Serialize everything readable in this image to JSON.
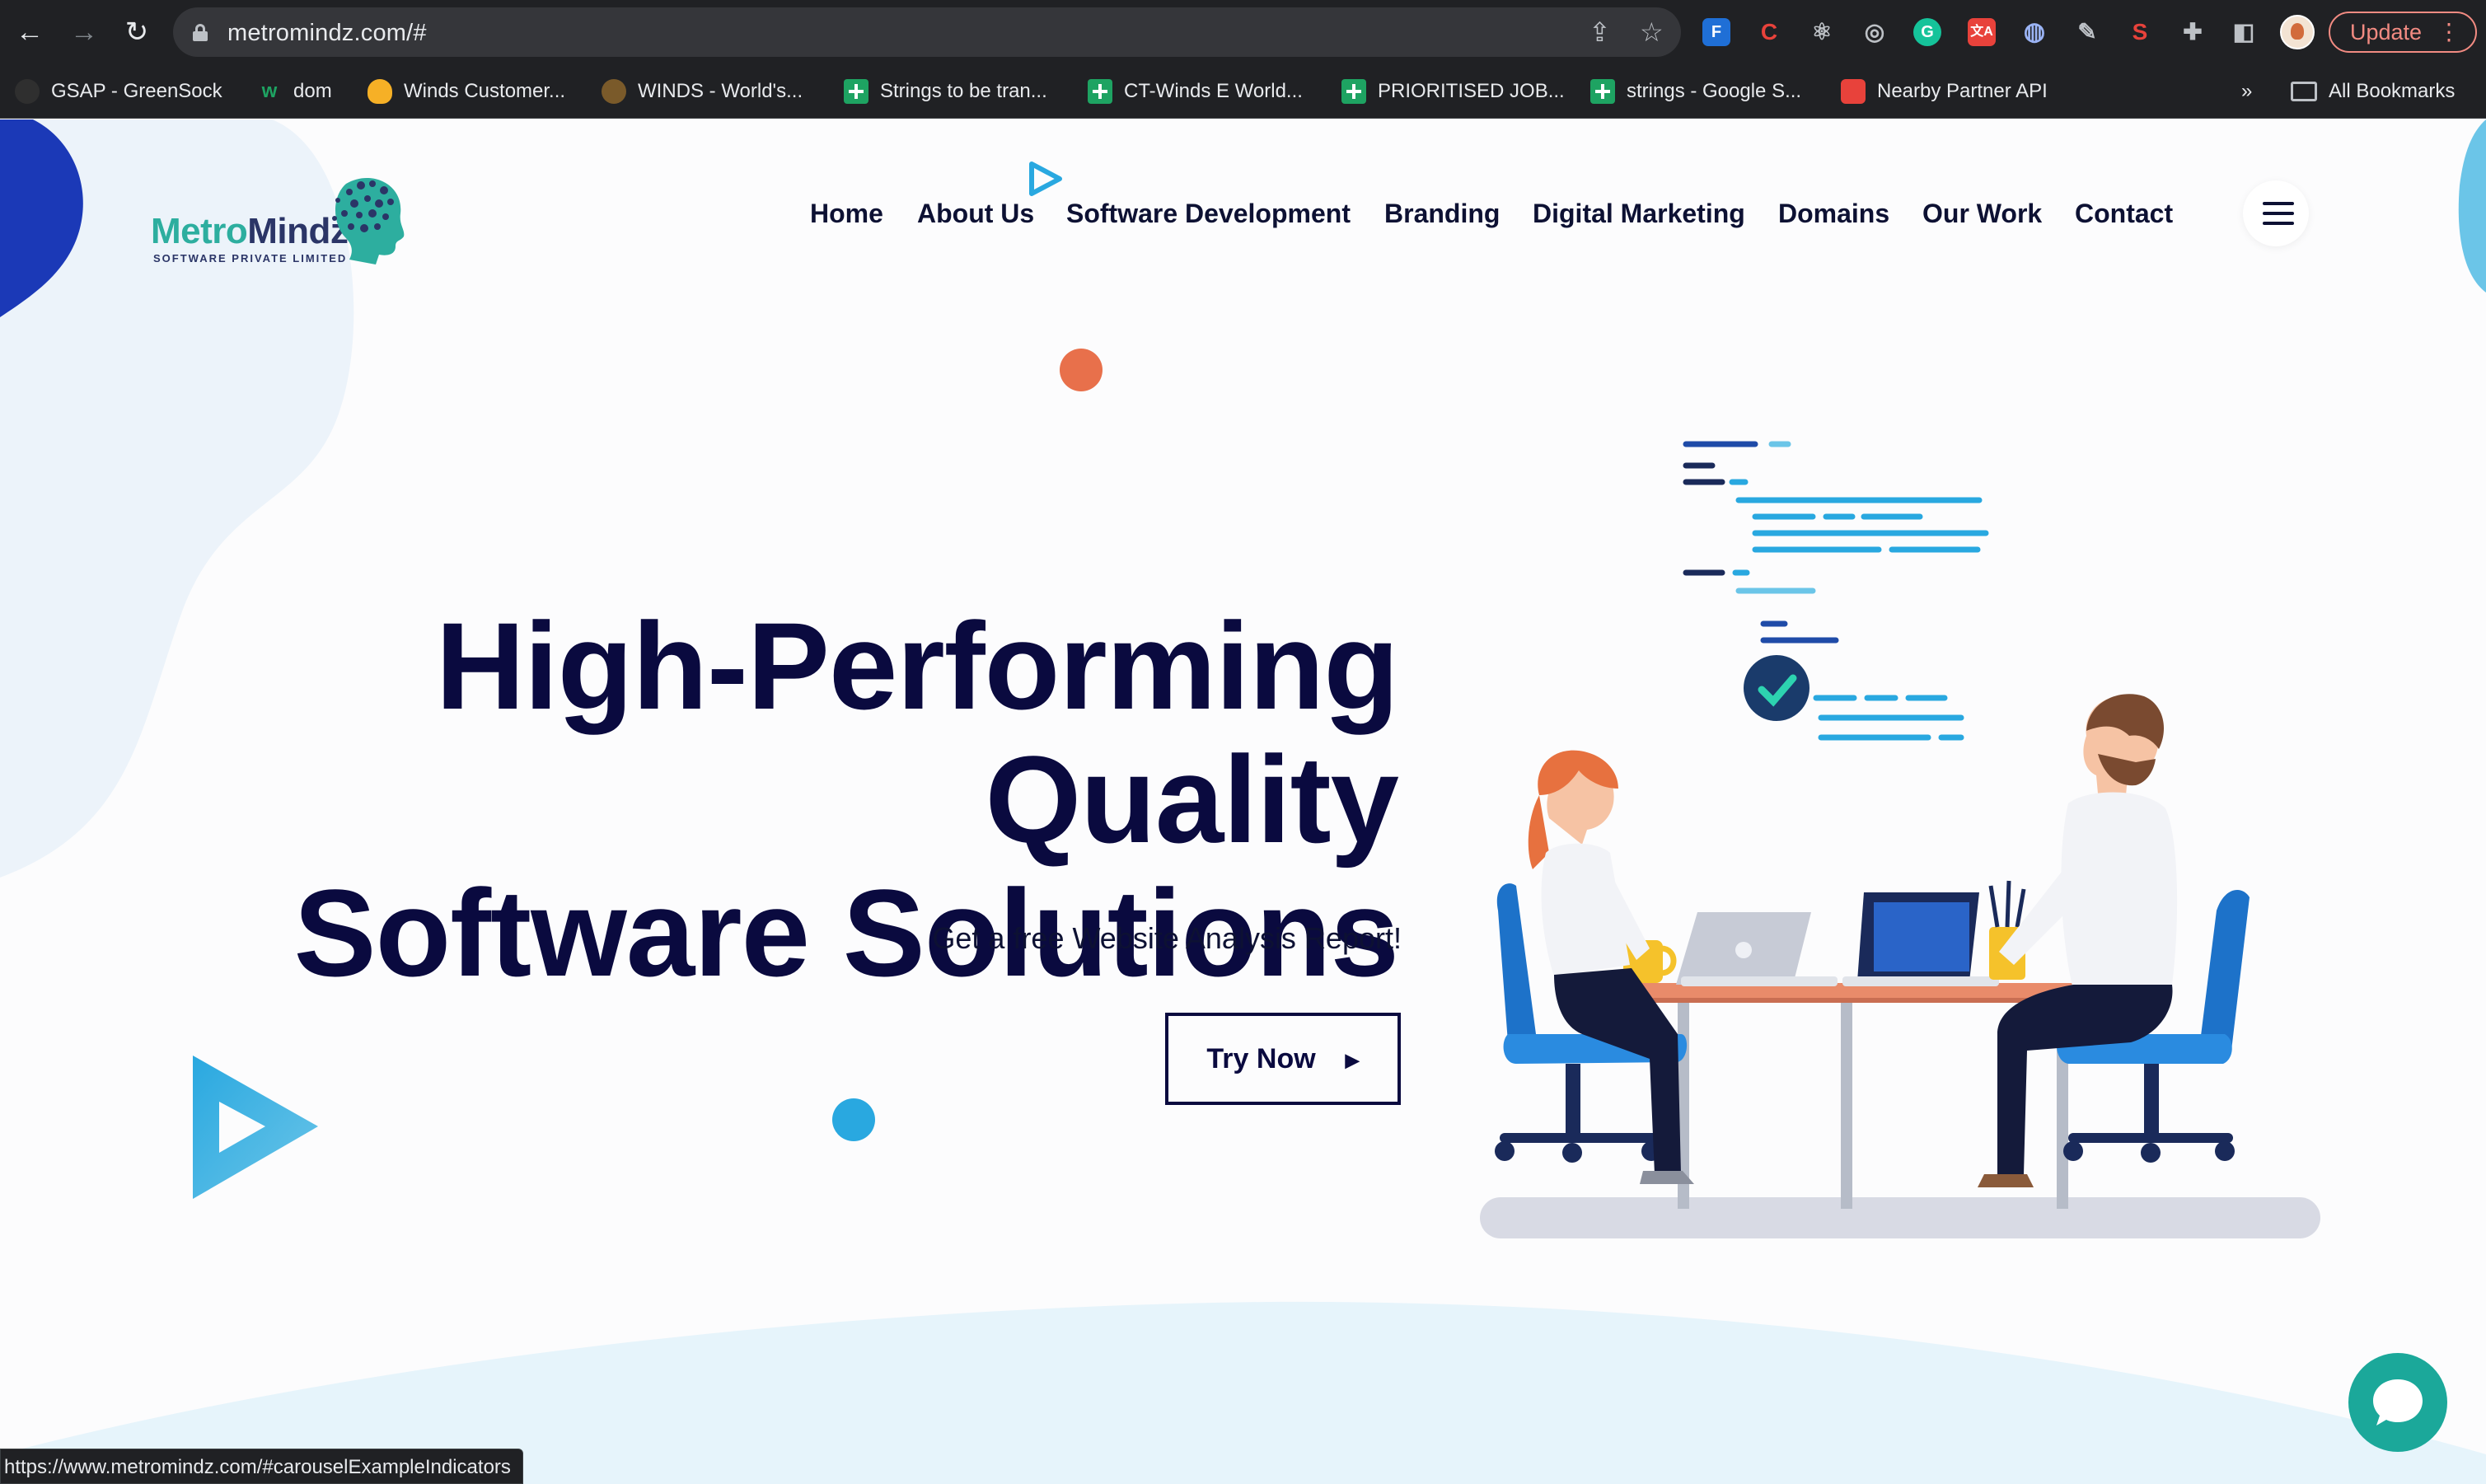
{
  "browser": {
    "url": "metromindz.com/#",
    "update_label": "Update",
    "bookmarks": [
      {
        "label": "GSAP - GreenSock",
        "icon": "greensock-icon"
      },
      {
        "label": "dom",
        "icon": "webflow-icon"
      },
      {
        "label": "Winds Customer...",
        "icon": "firebase-icon"
      },
      {
        "label": "WINDS - World's...",
        "icon": "winds-icon"
      },
      {
        "label": "Strings to be tran...",
        "icon": "sheets-icon"
      },
      {
        "label": "CT-Winds E World...",
        "icon": "sheets-icon"
      },
      {
        "label": "PRIORITISED JOB...",
        "icon": "sheets-icon"
      },
      {
        "label": "strings - Google S...",
        "icon": "sheets-icon"
      },
      {
        "label": "Nearby Partner API",
        "icon": "api-icon"
      }
    ],
    "more_bookmarks": "»",
    "all_bookmarks": "All Bookmarks",
    "status_url": "https://www.metromindz.com/#carouselExampleIndicators"
  },
  "site": {
    "logo": {
      "part1": "Metro",
      "part2": "Mindz",
      "tagline": "SOFTWARE PRIVATE LIMITED"
    },
    "nav": [
      "Home",
      "About Us",
      "Software Development",
      "Branding",
      "Digital Marketing",
      "Domains",
      "Our Work",
      "Contact"
    ],
    "hero": {
      "lines": [
        "High-Performing",
        "Quality",
        "Software Solutions"
      ],
      "subtitle": "Get a free Website Analysis Report!",
      "cta": "Try Now"
    }
  },
  "colors": {
    "navy": "#0a0a3f",
    "teal": "#2dae9f",
    "accent_blue": "#29a8e0",
    "accent_orange": "#e8704b",
    "chat_green": "#1ba89a"
  }
}
